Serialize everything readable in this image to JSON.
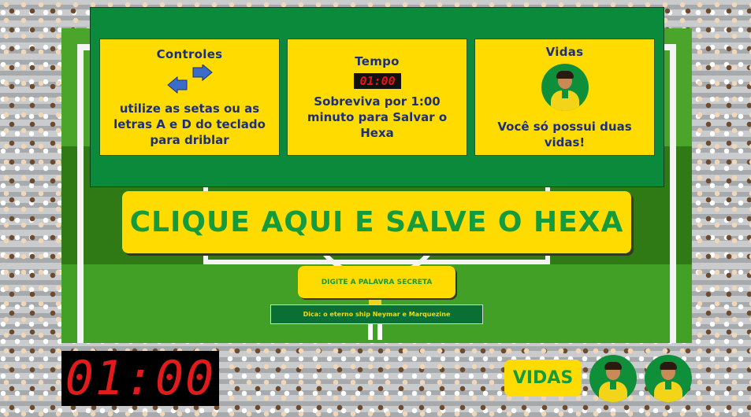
{
  "instructions": {
    "controls": {
      "title": "Controles",
      "text": "utilize as setas ou as letras A e D do teclado para driblar",
      "icon": "arrows-icon"
    },
    "time": {
      "title": "Tempo",
      "timer": "01:00",
      "text": "Sobreviva por 1:00 minuto para Salvar o Hexa"
    },
    "lives": {
      "title": "Vidas",
      "text": "Você só possui duas vidas!",
      "icon": "player-avatar-icon"
    }
  },
  "cta": {
    "label": "CLIQUE AQUI E SALVE O HEXA"
  },
  "secret": {
    "button_label": "DIGITE A PALAVRA SECRETA",
    "hint": "Dica: o eterno ship Neymar e Marquezine"
  },
  "hud": {
    "timer": "01:00",
    "lives_label": "VIDAS",
    "lives_remaining": 2
  },
  "colors": {
    "yellow": "#ffdb00",
    "green": "#0a8a3a",
    "blue_text": "#1b2f7a",
    "timer_red": "#e11b1b"
  }
}
